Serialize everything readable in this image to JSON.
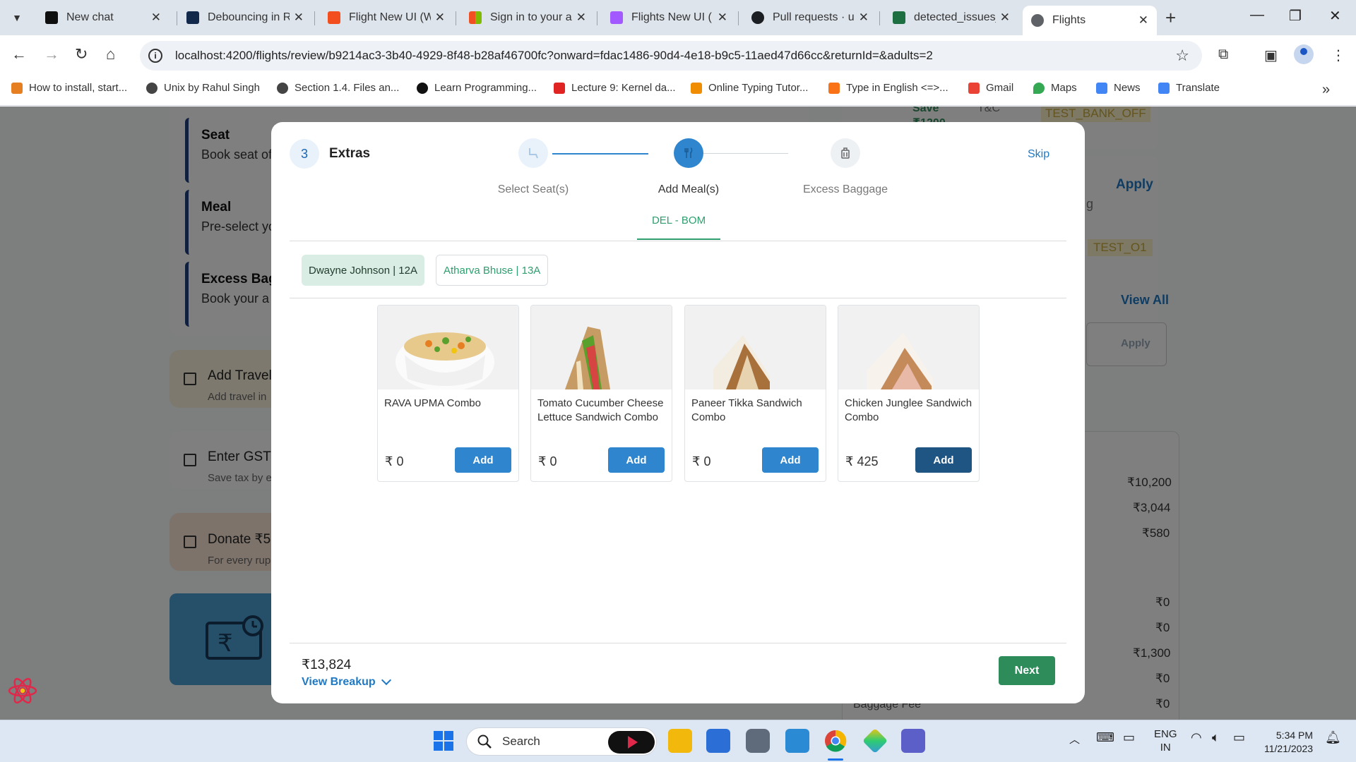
{
  "browser": {
    "tabs": [
      {
        "title": "New chat",
        "color": "#0f0f0f"
      },
      {
        "title": "Debouncing in R",
        "color": "#13294b"
      },
      {
        "title": "Flight New UI (W",
        "color": "#f24e1e"
      },
      {
        "title": "Sign in to your a",
        "color": "#f25022"
      },
      {
        "title": "Flights New UI (",
        "color": "#a259ff"
      },
      {
        "title": "Pull requests · u",
        "color": "#1b1f23"
      },
      {
        "title": "detected_issues_",
        "color": "#1d6f42"
      },
      {
        "title": "Flights",
        "color": "#5f6368"
      }
    ],
    "url": "localhost:4200/flights/review/b9214ac3-3b40-4929-8f48-b28af46700fc?onward=fdac1486-90d4-4e18-b9c5-11aed47d66cc&returnId=&adults=2",
    "bookmarks": [
      {
        "label": "How to install, start...",
        "color": "#e67e22"
      },
      {
        "label": "Unix by Rahul Singh",
        "color": "#444"
      },
      {
        "label": "Section 1.4.  Files an...",
        "color": "#444"
      },
      {
        "label": "Learn Programming...",
        "color": "#111"
      },
      {
        "label": "Lecture 9: Kernel da...",
        "color": "#e02424"
      },
      {
        "label": "Online Typing Tutor...",
        "color": "#f08c00"
      },
      {
        "label": "Type in English <=>...",
        "color": "#f97316"
      },
      {
        "label": "Gmail",
        "color": "#ea4335"
      },
      {
        "label": "Maps",
        "color": "#34a853"
      },
      {
        "label": "News",
        "color": "#4285f4"
      },
      {
        "label": "Translate",
        "color": "#4285f4"
      }
    ]
  },
  "background": {
    "cards": [
      {
        "title": "Seat",
        "sub": "Book seat of"
      },
      {
        "title": "Meal",
        "sub": "Pre-select yo"
      },
      {
        "title": "Excess Bagg",
        "sub": "Book your a"
      }
    ],
    "checks": [
      {
        "title": "Add Travel I",
        "sub": "Add travel in"
      },
      {
        "title": "Enter GST D",
        "sub": "Save tax by e"
      },
      {
        "title": "Donate ₹5 t",
        "sub": "For every rup"
      }
    ],
    "right": {
      "save": "Save",
      "save_amt": "₹1200",
      "tc": "T&C",
      "apply": "Apply",
      "code1": "TEST_BANK_OFF",
      "g": "g",
      "code2": "TEST_O1",
      "view_all": "View All",
      "apply_btn": "Apply",
      "amounts": [
        "₹10,200",
        "₹3,044",
        "₹580",
        "₹0",
        "₹0",
        "₹1,300",
        "₹0",
        "₹0"
      ],
      "baggage_fee": "Baggage Fee"
    }
  },
  "modal": {
    "step_number": "3",
    "title": "Extras",
    "skip": "Skip",
    "steps": [
      {
        "label": "Select Seat(s)",
        "state": "done"
      },
      {
        "label": "Add Meal(s)",
        "state": "active"
      },
      {
        "label": "Excess Baggage",
        "state": "pending"
      }
    ],
    "route": "DEL - BOM",
    "passengers": [
      {
        "label": "Dwayne Johnson | 12A",
        "selected": true
      },
      {
        "label": "Atharva Bhuse | 13A",
        "selected": false
      }
    ],
    "meals": [
      {
        "name": "RAVA UPMA Combo",
        "price": "₹ 0",
        "button": "Add",
        "image": "upma-bowl"
      },
      {
        "name": "Tomato Cucumber Cheese Lettuce Sandwich Combo",
        "price": "₹ 0",
        "button": "Add",
        "image": "veg-sandwich"
      },
      {
        "name": "Paneer Tikka Sandwich Combo",
        "price": "₹ 0",
        "button": "Add",
        "image": "paneer-sandwich"
      },
      {
        "name": "Chicken Junglee Sandwich Combo",
        "price": "₹ 425",
        "button": "Add",
        "image": "chicken-sandwich"
      }
    ],
    "total": "₹13,824",
    "view_breakup": "View Breakup",
    "next": "Next"
  },
  "taskbar": {
    "search": "Search",
    "lang1": "ENG",
    "lang2": "IN",
    "time": "5:34 PM",
    "date": "11/21/2023"
  },
  "colors": {
    "primary_blue": "#2f86cf",
    "dark_blue": "#1e5583",
    "green": "#2e8c5a",
    "route_green": "#2e9e6e"
  }
}
